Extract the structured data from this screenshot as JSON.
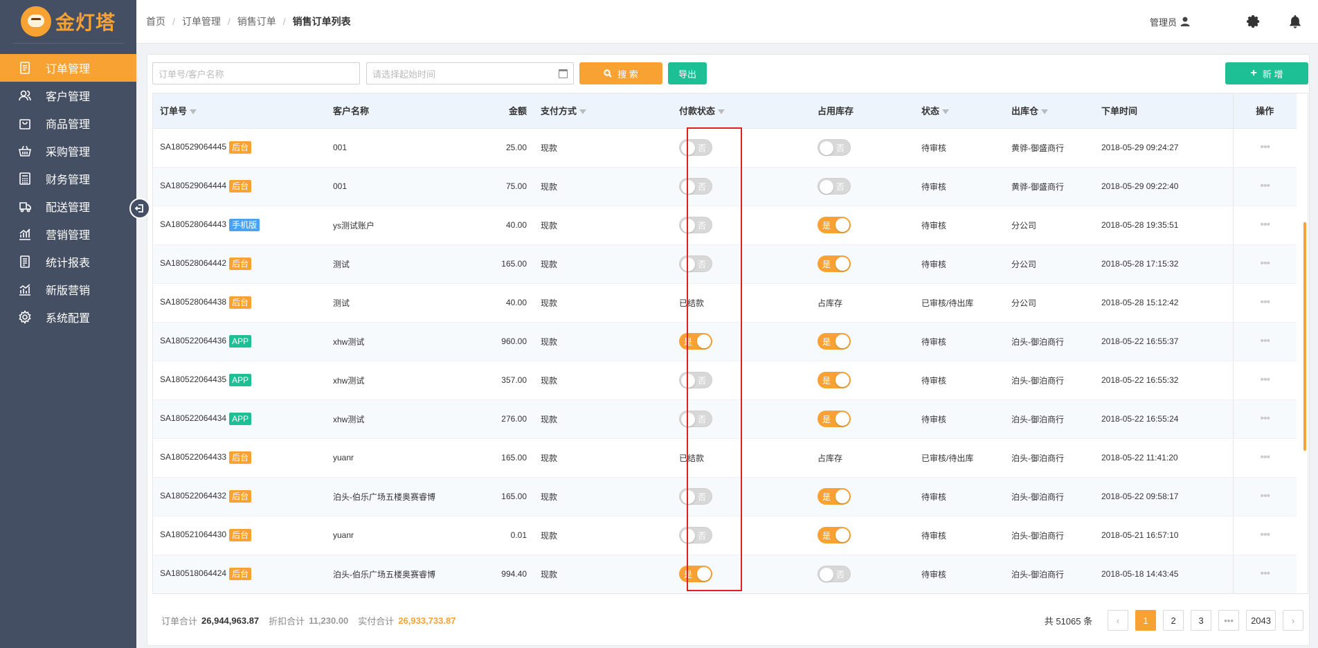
{
  "brand": {
    "name": "金灯塔",
    "logo_icon": "lighthouse-mascot-icon",
    "accent": "#f7a233"
  },
  "sidebar": {
    "items": [
      {
        "label": "订单管理",
        "icon": "order-icon",
        "active": true
      },
      {
        "label": "客户管理",
        "icon": "customers-icon",
        "active": false
      },
      {
        "label": "商品管理",
        "icon": "shopping-bag-icon",
        "active": false
      },
      {
        "label": "采购管理",
        "icon": "basket-icon",
        "active": false
      },
      {
        "label": "财务管理",
        "icon": "calculator-icon",
        "active": false
      },
      {
        "label": "配送管理",
        "icon": "truck-icon",
        "active": false
      },
      {
        "label": "营销管理",
        "icon": "chart-icon",
        "active": false
      },
      {
        "label": "统计报表",
        "icon": "report-icon",
        "active": false
      },
      {
        "label": "新版营销",
        "icon": "new-chart-icon",
        "active": false
      },
      {
        "label": "系统配置",
        "icon": "gear-icon",
        "active": false
      }
    ]
  },
  "header": {
    "breadcrumb": [
      "首页",
      "订单管理",
      "销售订单",
      "销售订单列表"
    ],
    "user": "管理员"
  },
  "toolbar": {
    "search_placeholder": "订单号/客户名称",
    "date_placeholder": "请选择起始时间",
    "search_label": "搜 索",
    "export_label": "导出",
    "new_label": "新 增"
  },
  "table": {
    "columns": {
      "order_no": "订单号",
      "customer": "客户名称",
      "amount": "金额",
      "payment": "支付方式",
      "pay_status": "付款状态",
      "stock": "占用库存",
      "status": "状态",
      "warehouse": "出库仓",
      "time": "下单时间",
      "op": "操作"
    },
    "rows": [
      {
        "order_no": "SA180529064445",
        "tag": "后台",
        "customer": "001",
        "amount": "25.00",
        "payment": "现款",
        "pay_status": "toggle",
        "pay_on": false,
        "stock": "toggle",
        "stock_on": false,
        "status": "待审核",
        "warehouse": "黄骅-御盛商行",
        "time": "2018-05-29 09:24:27"
      },
      {
        "order_no": "SA180529064444",
        "tag": "后台",
        "customer": "001",
        "amount": "75.00",
        "payment": "现款",
        "pay_status": "toggle",
        "pay_on": false,
        "stock": "toggle",
        "stock_on": false,
        "status": "待审核",
        "warehouse": "黄骅-御盛商行",
        "time": "2018-05-29 09:22:40"
      },
      {
        "order_no": "SA180528064443",
        "tag": "手机版",
        "customer": "ys测试账户",
        "amount": "40.00",
        "payment": "现款",
        "pay_status": "toggle",
        "pay_on": false,
        "stock": "toggle",
        "stock_on": true,
        "status": "待审核",
        "warehouse": "分公司",
        "time": "2018-05-28 19:35:51"
      },
      {
        "order_no": "SA180528064442",
        "tag": "后台",
        "customer": "测试",
        "amount": "165.00",
        "payment": "现款",
        "pay_status": "toggle",
        "pay_on": false,
        "stock": "toggle",
        "stock_on": true,
        "status": "待审核",
        "warehouse": "分公司",
        "time": "2018-05-28 17:15:32"
      },
      {
        "order_no": "SA180528064438",
        "tag": "后台",
        "customer": "测试",
        "amount": "40.00",
        "payment": "现款",
        "pay_status": "已结款",
        "pay_on": null,
        "stock": "占库存",
        "stock_on": null,
        "status": "已审核/待出库",
        "warehouse": "分公司",
        "time": "2018-05-28 15:12:42"
      },
      {
        "order_no": "SA180522064436",
        "tag": "APP",
        "customer": "xhw测试",
        "amount": "960.00",
        "payment": "现款",
        "pay_status": "toggle",
        "pay_on": true,
        "stock": "toggle",
        "stock_on": true,
        "status": "待审核",
        "warehouse": "泊头-御泊商行",
        "time": "2018-05-22 16:55:37"
      },
      {
        "order_no": "SA180522064435",
        "tag": "APP",
        "customer": "xhw测试",
        "amount": "357.00",
        "payment": "现款",
        "pay_status": "toggle",
        "pay_on": false,
        "stock": "toggle",
        "stock_on": true,
        "status": "待审核",
        "warehouse": "泊头-御泊商行",
        "time": "2018-05-22 16:55:32"
      },
      {
        "order_no": "SA180522064434",
        "tag": "APP",
        "customer": "xhw测试",
        "amount": "276.00",
        "payment": "现款",
        "pay_status": "toggle",
        "pay_on": false,
        "stock": "toggle",
        "stock_on": true,
        "status": "待审核",
        "warehouse": "泊头-御泊商行",
        "time": "2018-05-22 16:55:24"
      },
      {
        "order_no": "SA180522064433",
        "tag": "后台",
        "customer": "yuanr",
        "amount": "165.00",
        "payment": "现款",
        "pay_status": "已结款",
        "pay_on": null,
        "stock": "占库存",
        "stock_on": null,
        "status": "已审核/待出库",
        "warehouse": "泊头-御泊商行",
        "time": "2018-05-22 11:41:20"
      },
      {
        "order_no": "SA180522064432",
        "tag": "后台",
        "customer": "泊头-伯乐广场五楼奥赛睿博",
        "amount": "165.00",
        "payment": "现款",
        "pay_status": "toggle",
        "pay_on": false,
        "stock": "toggle",
        "stock_on": true,
        "status": "待审核",
        "warehouse": "泊头-御泊商行",
        "time": "2018-05-22 09:58:17"
      },
      {
        "order_no": "SA180521064430",
        "tag": "后台",
        "customer": "yuanr",
        "amount": "0.01",
        "payment": "现款",
        "pay_status": "toggle",
        "pay_on": false,
        "stock": "toggle",
        "stock_on": true,
        "status": "待审核",
        "warehouse": "泊头-御泊商行",
        "time": "2018-05-21 16:57:10"
      },
      {
        "order_no": "SA180518064424",
        "tag": "后台",
        "customer": "泊头-伯乐广场五楼奥赛睿博",
        "amount": "994.40",
        "payment": "现款",
        "pay_status": "toggle",
        "pay_on": true,
        "stock": "toggle",
        "stock_on": false,
        "status": "待审核",
        "warehouse": "泊头-御泊商行",
        "time": "2018-05-18 14:43:45"
      }
    ],
    "toggle_on_label": "是",
    "toggle_off_label": "否",
    "op_label": "•••",
    "tag_colors": {
      "后台": "#f7a233",
      "手机版": "#4aa3f0",
      "APP": "#1dbf94"
    }
  },
  "footer": {
    "order_total_label": "订单合计",
    "order_total": "26,944,963.87",
    "discount_label": "折扣合计",
    "discount_total": "11,230.00",
    "paid_label": "实付合计",
    "paid_total": "26,933,733.87",
    "count_text": "共 51065 条",
    "pages": [
      "1",
      "2",
      "3",
      "•••",
      "2043"
    ],
    "current_page": "1",
    "prev": "‹",
    "next": "›"
  }
}
